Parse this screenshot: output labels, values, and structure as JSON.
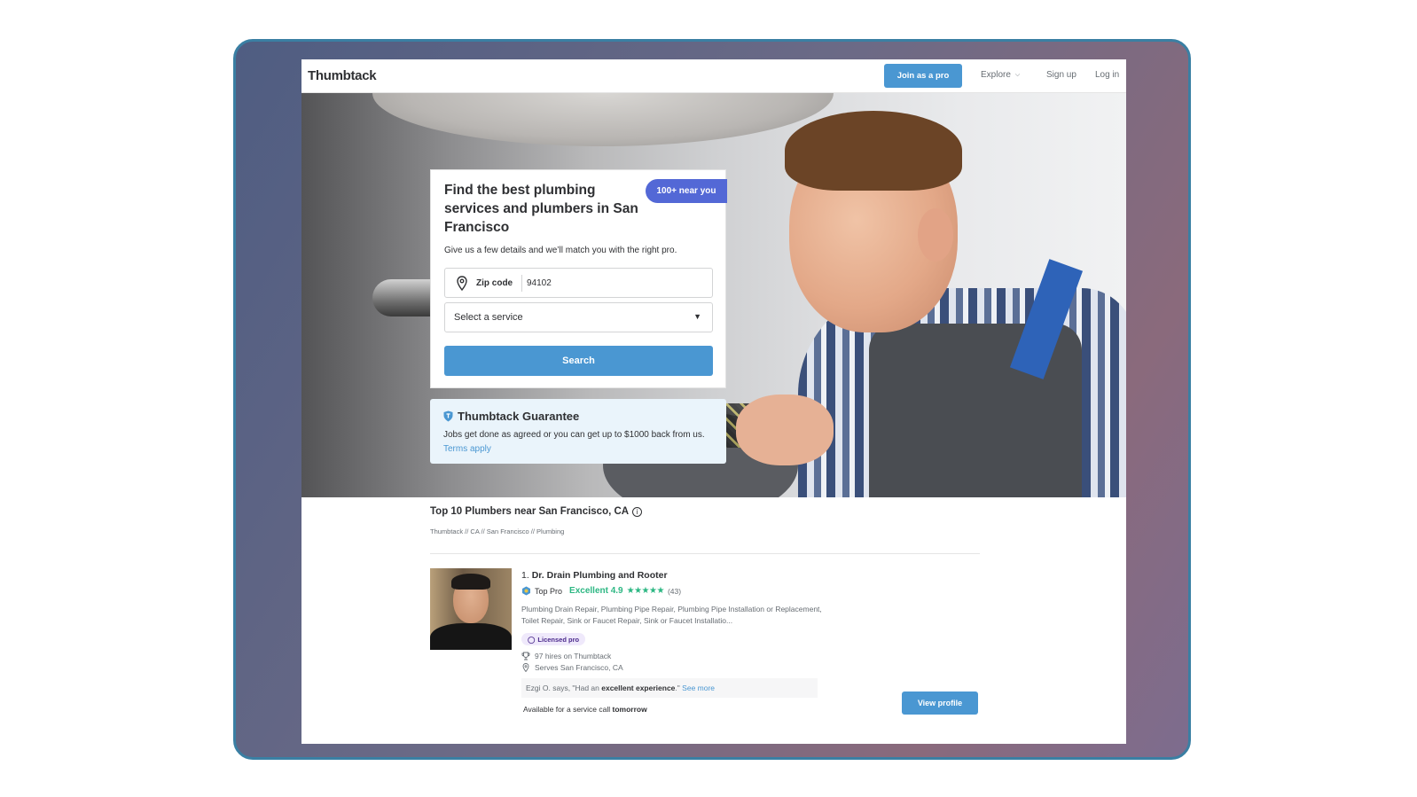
{
  "nav": {
    "logo": "Thumbtack",
    "join_label": "Join as a pro",
    "explore_label": "Explore",
    "signup_label": "Sign up",
    "login_label": "Log in"
  },
  "hero": {
    "title": "Find the best plumbing services and plumbers in San Francisco",
    "badge": "100+ near you",
    "subtitle": "Give us a few details and we’ll match you with the right pro.",
    "zip_label": "Zip code",
    "zip_value": "94102",
    "service_placeholder": "Select a service",
    "search_label": "Search"
  },
  "guarantee": {
    "title": "Thumbtack Guarantee",
    "text": "Jobs get done as agreed or you can get up to $1000 back from us.",
    "link": "Terms apply"
  },
  "listing": {
    "title": "Top 10 Plumbers near San Francisco, CA",
    "breadcrumb": "Thumbtack // CA // San Francisco // Plumbing",
    "pro": {
      "rank": "1.",
      "name": "Dr. Drain Plumbing and Rooter",
      "top_pro": "Top Pro",
      "rating_text": "Excellent 4.9",
      "stars": "★★★★★",
      "reviews": "(43)",
      "services": "Plumbing Drain Repair, Plumbing Pipe Repair, Plumbing Pipe Installation or Replacement, Toilet Repair, Sink or Faucet Repair, Sink or Faucet Installatio...",
      "licensed": "Licensed pro",
      "hires": "97 hires on Thumbtack",
      "serves": "Serves San Francisco, CA",
      "quote_prefix": "Ezgi O. says, \"Had an ",
      "quote_bold": "excellent experience",
      "quote_suffix": ".\"",
      "see_more": "See more",
      "avail_prefix": "Available for a service call ",
      "avail_bold": "tomorrow",
      "view_label": "View profile"
    }
  },
  "colors": {
    "accent": "#4a97d2",
    "badge": "#5368d6",
    "rating": "#2db783",
    "licensed_bg": "#efe9fb"
  }
}
